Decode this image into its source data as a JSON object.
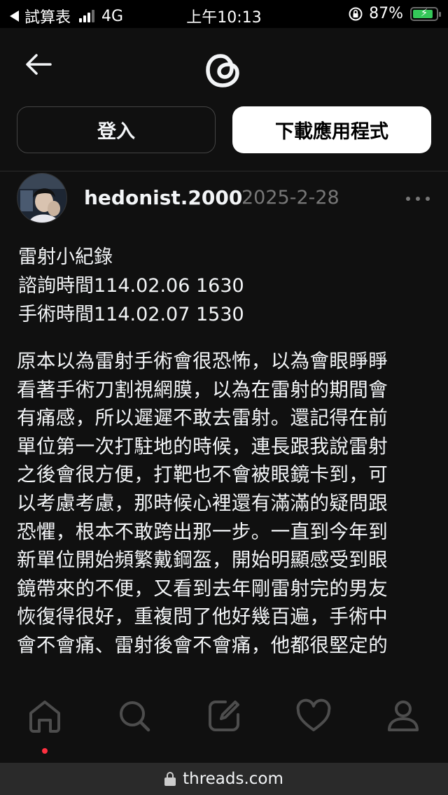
{
  "status_bar": {
    "back_app": "試算表",
    "network": "4G",
    "time": "上午10:13",
    "battery_percent": "87%",
    "battery_level": 0.87
  },
  "header": {
    "login_label": "登入",
    "download_label": "下載應用程式"
  },
  "post": {
    "username": "hedonist.2000",
    "date": "2025-2-28",
    "intro_lines": [
      "雷射小紀錄",
      "諮詢時間114.02.06 1630",
      "手術時間114.02.07 1530"
    ],
    "paragraph_lines": [
      "原本以為雷射手術會很恐怖，以為會眼睜睜",
      "看著手術刀割視網膜，以為在雷射的期間會",
      "有痛感，所以遲遲不敢去雷射。還記得在前",
      "單位第一次打駐地的時候，連長跟我說雷射",
      "之後會很方便，打靶也不會被眼鏡卡到，可",
      "以考慮考慮，那時候心裡還有滿滿的疑問跟",
      "恐懼，根本不敢跨出那一步。一直到今年到",
      "新單位開始頻繁戴鋼盔，開始明顯感受到眼",
      "鏡帶來的不便，又看到去年剛雷射完的男友",
      "恢復得很好，重複問了他好幾百遍，手術中",
      "會不會痛、雷射後會不會痛，他都很堅定的"
    ]
  },
  "nav": {
    "icons": [
      "home-icon",
      "search-icon",
      "compose-icon",
      "heart-icon",
      "profile-icon"
    ],
    "active": "home"
  },
  "url_bar": {
    "domain": "threads.com"
  },
  "colors": {
    "background": "#101010",
    "text": "#f3f5f7",
    "muted": "#777777",
    "notification_dot": "#ff3040"
  }
}
